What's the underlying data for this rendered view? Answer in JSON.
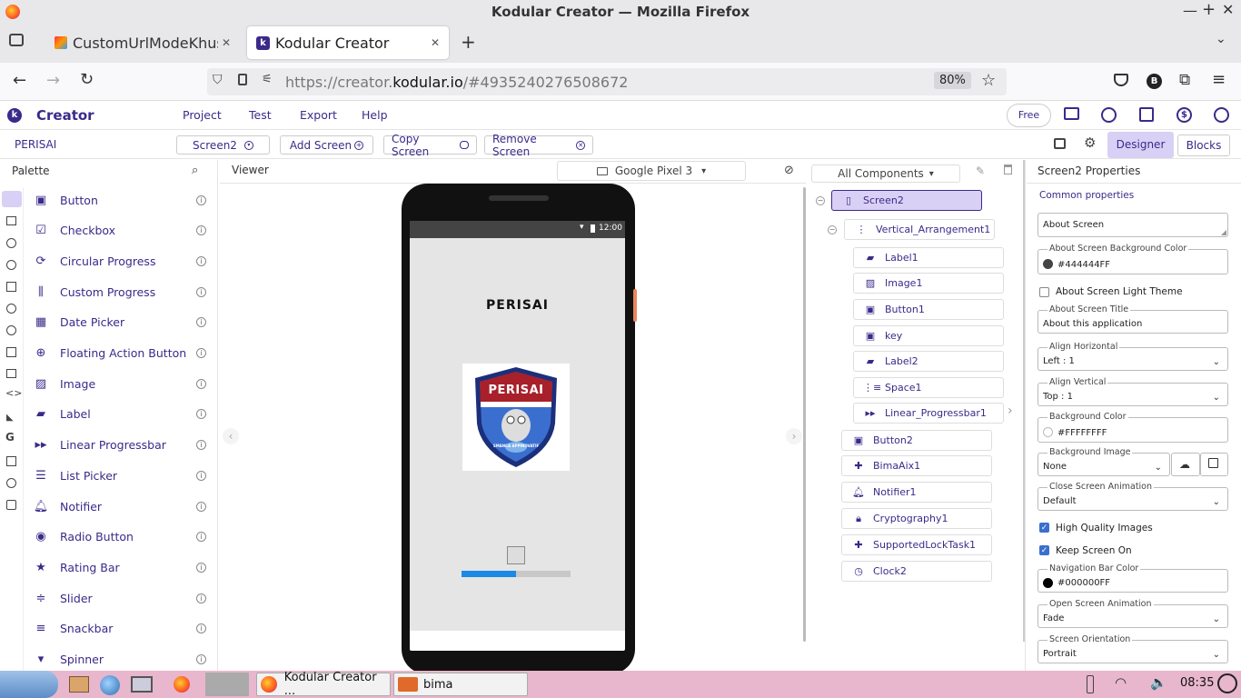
{
  "window": {
    "title": "Kodular Creator — Mozilla Firefox"
  },
  "tabs": [
    {
      "label": "CustomUrlModeKhusu"
    },
    {
      "label": "Kodular Creator"
    }
  ],
  "navbar": {
    "url_prefix": "https://creator.",
    "url_domain": "kodular.io",
    "url_suffix": "/#4935240276508672",
    "zoom": "80%",
    "profile_letter": "B"
  },
  "app": {
    "brand": "Creator",
    "menu": [
      "Project",
      "Test",
      "Export",
      "Help"
    ],
    "plan_badge": "Free"
  },
  "screenbar": {
    "project": "PERISAI",
    "screen": "Screen2",
    "add_screen": "Add Screen",
    "copy_screen": "Copy Screen",
    "remove_screen": "Remove Screen",
    "designer": "Designer",
    "blocks": "Blocks"
  },
  "palette": {
    "title": "Palette",
    "items": [
      {
        "label": "Button",
        "icon": "button-icon"
      },
      {
        "label": "Checkbox",
        "icon": "checkbox-icon"
      },
      {
        "label": "Circular Progress",
        "icon": "circular-progress-icon"
      },
      {
        "label": "Custom Progress",
        "icon": "custom-progress-icon"
      },
      {
        "label": "Date Picker",
        "icon": "calendar-icon"
      },
      {
        "label": "Floating Action Button",
        "icon": "fab-icon"
      },
      {
        "label": "Image",
        "icon": "image-icon"
      },
      {
        "label": "Label",
        "icon": "label-icon"
      },
      {
        "label": "Linear Progressbar",
        "icon": "linear-progress-icon"
      },
      {
        "label": "List Picker",
        "icon": "list-icon"
      },
      {
        "label": "Notifier",
        "icon": "bell-icon"
      },
      {
        "label": "Radio Button",
        "icon": "radio-icon"
      },
      {
        "label": "Rating Bar",
        "icon": "star-icon"
      },
      {
        "label": "Slider",
        "icon": "slider-icon"
      },
      {
        "label": "Snackbar",
        "icon": "snackbar-icon"
      },
      {
        "label": "Spinner",
        "icon": "spinner-icon"
      }
    ]
  },
  "viewer": {
    "title": "Viewer",
    "device": "Google Pixel 3",
    "status_time": "12:00",
    "screen_label": "PERISAI",
    "logo_text": "PERISAI",
    "logo_subtext": "SMANCA APPINOVATIF",
    "progress": 0.5
  },
  "components": {
    "filter": "All Components",
    "tree": [
      {
        "label": "Screen2",
        "level": 0
      },
      {
        "label": "Vertical_Arrangement1",
        "level": 1
      },
      {
        "label": "Label1",
        "level": 2
      },
      {
        "label": "Image1",
        "level": 2
      },
      {
        "label": "Button1",
        "level": 2
      },
      {
        "label": "key",
        "level": 2
      },
      {
        "label": "Label2",
        "level": 2
      },
      {
        "label": "Space1",
        "level": 2
      },
      {
        "label": "Linear_Progressbar1",
        "level": 2
      },
      {
        "label": "Button2",
        "level": 1
      },
      {
        "label": "BimaAix1",
        "level": 1
      },
      {
        "label": "Notifier1",
        "level": 1
      },
      {
        "label": "Cryptography1",
        "level": 1
      },
      {
        "label": "SupportedLockTask1",
        "level": 1
      },
      {
        "label": "Clock2",
        "level": 1
      }
    ]
  },
  "properties": {
    "title": "Screen2 Properties",
    "section": "Common properties",
    "about_screen": "About Screen",
    "bg_color_label": "About Screen Background Color",
    "bg_color_value": "#444444FF",
    "light_theme": "About Screen Light Theme",
    "about_title_label": "About Screen Title",
    "about_title_value": "About this application",
    "align_h_label": "Align Horizontal",
    "align_h_value": "Left : 1",
    "align_v_label": "Align Vertical",
    "align_v_value": "Top : 1",
    "background_color_label": "Background Color",
    "background_color_value": "#FFFFFFFF",
    "background_image_label": "Background Image",
    "background_image_value": "None",
    "close_anim_label": "Close Screen Animation",
    "close_anim_value": "Default",
    "high_quality": "High Quality Images",
    "keep_on": "Keep Screen On",
    "nav_color_label": "Navigation Bar Color",
    "nav_color_value": "#000000FF",
    "open_anim_label": "Open Screen Animation",
    "open_anim_value": "Fade",
    "orientation_label": "Screen Orientation",
    "orientation_value": "Portrait"
  },
  "taskbar": {
    "firefox_task": "Kodular Creator ...",
    "folder_task": "bima",
    "clock": "08:35"
  },
  "colors": {
    "accent": "#3b2a8a",
    "selected": "#d9d0f5",
    "taskbar": "#e8b6cd"
  }
}
